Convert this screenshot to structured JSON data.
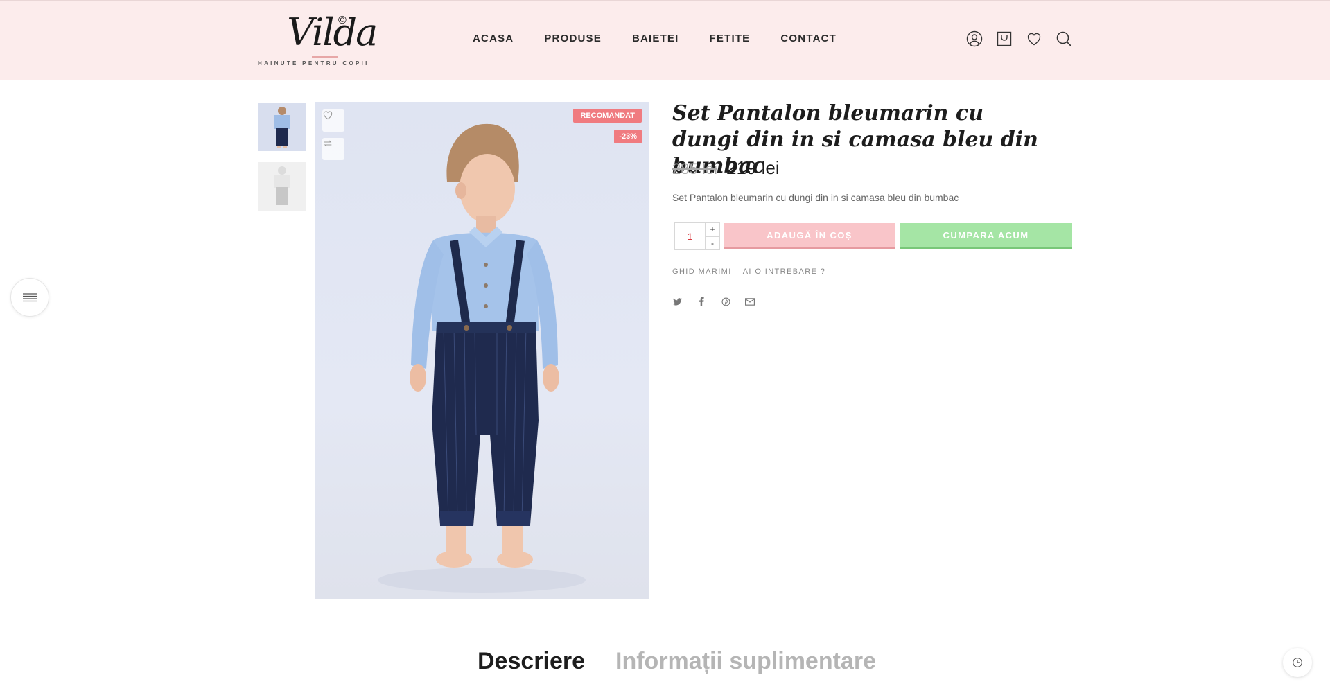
{
  "brand": {
    "name": "Vilda",
    "copyright": "©",
    "tagline": "HAINUTE PENTRU COPII"
  },
  "nav": {
    "items": [
      "ACASA",
      "PRODUSE",
      "BAIETEI",
      "FETITE",
      "CONTACT"
    ]
  },
  "header_icons": [
    "user-icon",
    "cart-icon",
    "heart-icon",
    "search-icon"
  ],
  "product": {
    "title": "Set Pantalon bleumarin cu dungi din in si camasa bleu din bumbac",
    "price_old": "285 lei",
    "price_new": "219 lei",
    "short_description": "Set Pantalon bleumarin cu dungi din in si camasa bleu din bumbac",
    "badge_recommended": "RECOMANDAT",
    "badge_discount": "-23%",
    "quantity": "1",
    "qty_plus": "+",
    "qty_minus": "-",
    "add_to_cart": "ADAUGĂ ÎN COȘ",
    "buy_now": "CUMPARA ACUM",
    "size_guide": "GHID MARIMI",
    "ask_question": "AI O INTREBARE ?"
  },
  "share_icons": [
    "twitter-icon",
    "facebook-icon",
    "pinterest-icon",
    "email-icon"
  ],
  "tabs": {
    "description": "Descriere",
    "additional_info": "Informații suplimentare"
  },
  "colors": {
    "header_bg": "#fcecec",
    "cart_button": "#f9c5c9",
    "buy_button": "#a5e5a5",
    "badge": "#f07b80"
  }
}
